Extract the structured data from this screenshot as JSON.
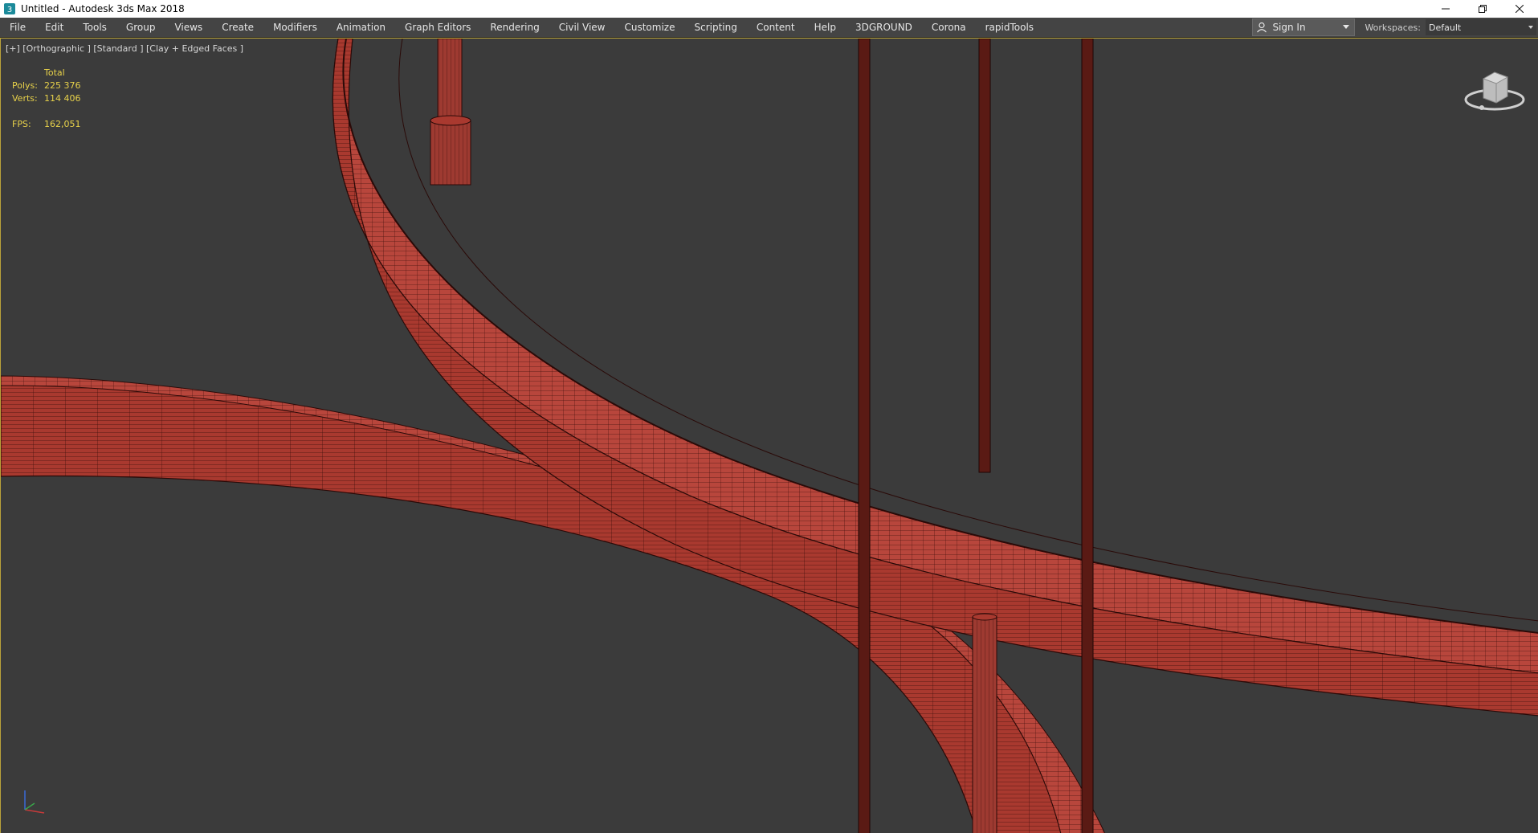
{
  "window": {
    "title": "Untitled - Autodesk 3ds Max 2018",
    "app_icon": "3dsmax-icon",
    "controls": [
      "minimize-icon",
      "restore-icon",
      "close-icon"
    ]
  },
  "menu": {
    "items": [
      "File",
      "Edit",
      "Tools",
      "Group",
      "Views",
      "Create",
      "Modifiers",
      "Animation",
      "Graph Editors",
      "Rendering",
      "Civil View",
      "Customize",
      "Scripting",
      "Content",
      "Help",
      "3DGROUND",
      "Corona",
      "rapidTools"
    ],
    "sign_in": "Sign In",
    "workspaces_label": "Workspaces:",
    "workspace_value": "Default"
  },
  "viewport": {
    "label": "[+] [Orthographic ] [Standard ] [Clay + Edged Faces ]",
    "stats": {
      "header": "Total",
      "polys_label": "Polys:",
      "polys_value": "225 376",
      "verts_label": "Verts:",
      "verts_value": "114 406",
      "fps_label": "FPS:",
      "fps_value": "162,051"
    },
    "colors": {
      "background": "#3b3b3b",
      "mesh_fill": "#b8463c",
      "mesh_edge": "#2a0a08",
      "active_border": "#b9a23a",
      "stats_text": "#e8d24a"
    }
  }
}
